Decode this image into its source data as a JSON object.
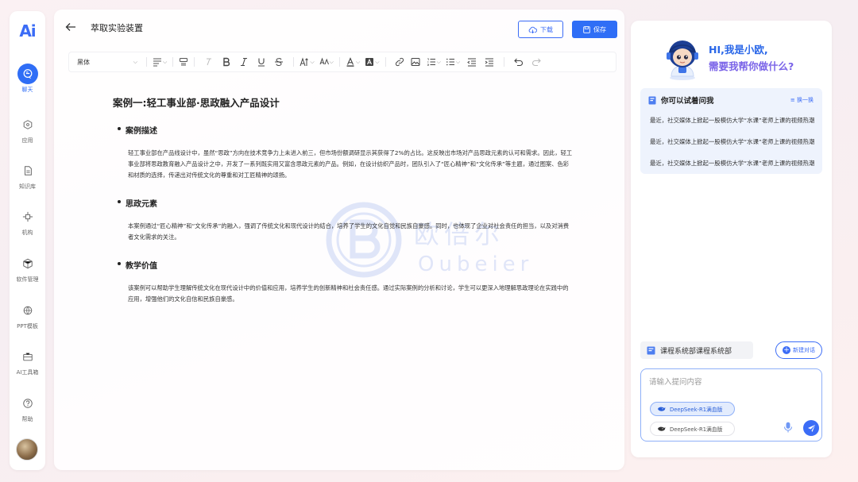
{
  "nav": {
    "logo": "Ai",
    "items": [
      {
        "label": "聊天",
        "icon": "chat-icon",
        "active": true
      },
      {
        "label": "应用",
        "icon": "apps-icon"
      },
      {
        "label": "知识库",
        "icon": "knowledge-base-icon"
      },
      {
        "label": "机构",
        "icon": "organization-icon"
      },
      {
        "label": "软件管理",
        "icon": "software-icon"
      },
      {
        "label": "PPT模板",
        "icon": "ppt-template-icon"
      },
      {
        "label": "AI工具箱",
        "icon": "toolbox-icon"
      },
      {
        "label": "帮助",
        "icon": "help-icon"
      }
    ],
    "avatar_icon": "user-avatar"
  },
  "editor": {
    "title": "萃取实验装置",
    "download_label": "下载",
    "save_label": "保存",
    "font": "黑体"
  },
  "document": {
    "heading": "案例一:轻工事业部·思政融入产品设计",
    "sections": [
      {
        "title": "案例描述",
        "text": "轻工事业部在产品线设计中，虽然“思政”方向在技术竞争力上未进入前三，但市场份额调研显示其获得了2%的占比。这反映出市场对产品思政元素的认可和需求。因此，轻工事业部将思政教育融入产品设计之中，开发了一系列既实用又富含思政元素的产品。例如，在设计纺织产品时，团队引入了“匠心精神”和“文化传承”等主题，通过图案、色彩和材质的选择，传递出对传统文化的尊重和对工匠精神的颂扬。"
      },
      {
        "title": "思政元素",
        "text": "本案例通过“匠心精神”和“文化传承”的融入，强调了传统文化和现代设计的结合，培养了学生的文化自觉和民族自豪感。同时，也体现了企业对社会责任的担当，以及对消费者文化需求的关注。"
      },
      {
        "title": "教学价值",
        "text": "该案例可以帮助学生理解传统文化在现代设计中的价值和应用，培养学生的创新精神和社会责任感。通过实际案例的分析和讨论，学生可以更深入地理解思政理论在实践中的应用，增强他们的文化自信和民族自豪感。"
      }
    ],
    "watermark_cn": "欧倍尔",
    "watermark_en": "Oubeier"
  },
  "assistant": {
    "greeting_line1": "HI,我是小欧,",
    "greeting_line2": "需要我帮你做什么?",
    "suggest_title": "你可以试着问我",
    "refresh_label": "≡ 换一换",
    "questions": [
      "最近，社交媒体上掀起一股模仿大学“水课”老师上课的视频热潮",
      "最近，社交媒体上掀起一股模仿大学“水课”老师上课的视频热潮",
      "最近，社交媒体上掀起一股模仿大学“水课”老师上课的视频热潮"
    ],
    "course_label": "课程系统部课程系统部",
    "new_chat_label": "新建对话",
    "input_placeholder": "请输入提问内容",
    "input_value": "",
    "models": [
      "DeepSeek-R1满血版",
      "DeepSeek-R1满血版"
    ]
  },
  "colors": {
    "accent": "#2f6ef6",
    "greeting_gradient_end": "#7a63e8",
    "suggest_bg": "#eef3fd"
  }
}
